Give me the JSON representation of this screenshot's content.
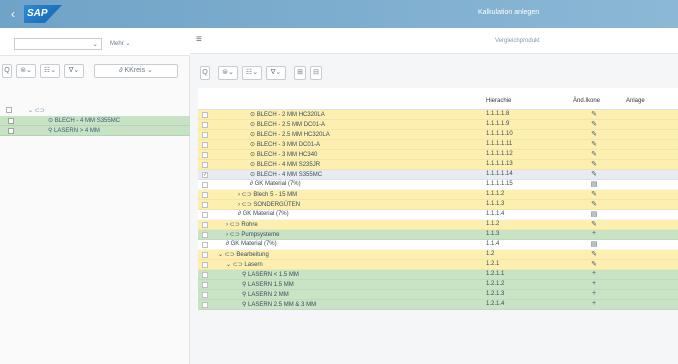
{
  "shell": {
    "back_glyph": "‹",
    "logo": "SAP",
    "title": "Kalkulation anlegen"
  },
  "left": {
    "select_chevron": "⌄",
    "more_label": "Mehr ⌄",
    "toolbar": [
      "Q",
      "⊜⌄",
      "☷⌄",
      "∇⌄",
      "∂ KKreis ⌄"
    ],
    "tree_head": "⌄ ⊂⊃",
    "rows": [
      {
        "label": "⊙ BLECH - 4 MM S355MC"
      },
      {
        "label": "⚲ LASERN > 4 MM"
      }
    ]
  },
  "right": {
    "hamburger": "≡",
    "subtitle": "Vergleichprodukt",
    "toolbar": [
      "Q",
      "⊜⌄",
      "☷⌄",
      "∇⌄",
      "⊞",
      "⊟"
    ],
    "columns": {
      "hierarchy": "Hierachie",
      "icon": "Änd.Ikone",
      "plant": "Anlage"
    },
    "rows": [
      {
        "name": "⊙ BLECH - 2 MM HC320LA",
        "hier": "1.1.1.1.8",
        "act": "✎",
        "bg": "yellow",
        "indent": 52,
        "check": ""
      },
      {
        "name": "⊙ BLECH - 2.5 MM DC01-A",
        "hier": "1.1.1.1.9",
        "act": "✎",
        "bg": "yellow",
        "indent": 52,
        "check": ""
      },
      {
        "name": "⊙ BLECH - 2.5 MM HC320LA",
        "hier": "1.1.1.1.10",
        "act": "✎",
        "bg": "yellow",
        "indent": 52,
        "check": ""
      },
      {
        "name": "⊙ BLECH - 3 MM DC01-A",
        "hier": "1.1.1.1.11",
        "act": "✎",
        "bg": "yellow",
        "indent": 52,
        "check": ""
      },
      {
        "name": "⊙ BLECH - 3 MM HC340",
        "hier": "1.1.1.1.12",
        "act": "✎",
        "bg": "yellow",
        "indent": 52,
        "check": ""
      },
      {
        "name": "⊙ BLECH - 4 MM S235JR",
        "hier": "1.1.1.1.13",
        "act": "✎",
        "bg": "yellow",
        "indent": 52,
        "check": ""
      },
      {
        "name": "⊙ BLECH - 4 MM S355MC",
        "hier": "1.1.1.1.14",
        "act": "✎",
        "bg": "selected",
        "indent": 52,
        "check": "✓"
      },
      {
        "name": "∂ GK Material (7%)",
        "hier": "1.1.1.1.15",
        "act": "▤",
        "bg": "white",
        "indent": 52,
        "check": ""
      },
      {
        "name": "› ⊂⊃ Blech 5 - 15 MM",
        "hier": "1.1.1.2",
        "act": "✎",
        "bg": "yellow",
        "indent": 40,
        "check": ""
      },
      {
        "name": "› ⊂⊃ SONDERGÜTEN",
        "hier": "1.1.1.3",
        "act": "✎",
        "bg": "yellow",
        "indent": 40,
        "check": ""
      },
      {
        "name": "∂ GK Material (7%)",
        "hier": "1.1.1.4",
        "act": "▤",
        "bg": "white",
        "indent": 40,
        "check": ""
      },
      {
        "name": "› ⊂⊃ Rohre",
        "hier": "1.1.2",
        "act": "✎",
        "bg": "yellow",
        "indent": 28,
        "check": ""
      },
      {
        "name": "› ⊂⊃ Pumpsysteme",
        "hier": "1.1.3",
        "act": "+",
        "bg": "green",
        "indent": 28,
        "check": ""
      },
      {
        "name": "∂ GK Material (7%)",
        "hier": "1.1.4",
        "act": "▤",
        "bg": "white",
        "indent": 28,
        "check": ""
      },
      {
        "name": "⌄ ⊂⊃ Bearbeitung",
        "hier": "1.2",
        "act": "✎",
        "bg": "yellow",
        "indent": 20,
        "check": ""
      },
      {
        "name": "⌄ ⊂⊃ Lasern",
        "hier": "1.2.1",
        "act": "✎",
        "bg": "yellow",
        "indent": 28,
        "check": ""
      },
      {
        "name": "⚲ LASERN < 1.5 MM",
        "hier": "1.2.1.1",
        "act": "+",
        "bg": "green",
        "indent": 44,
        "check": ""
      },
      {
        "name": "⚲ LASERN 1.5 MM",
        "hier": "1.2.1.2",
        "act": "+",
        "bg": "green",
        "indent": 44,
        "check": ""
      },
      {
        "name": "⚲ LASERN 2 MM",
        "hier": "1.2.1.3",
        "act": "+",
        "bg": "green",
        "indent": 44,
        "check": ""
      },
      {
        "name": "⚲ LASERN 2.5 MM & 3 MM",
        "hier": "1.2.1.4",
        "act": "+",
        "bg": "green",
        "indent": 44,
        "check": ""
      }
    ]
  }
}
